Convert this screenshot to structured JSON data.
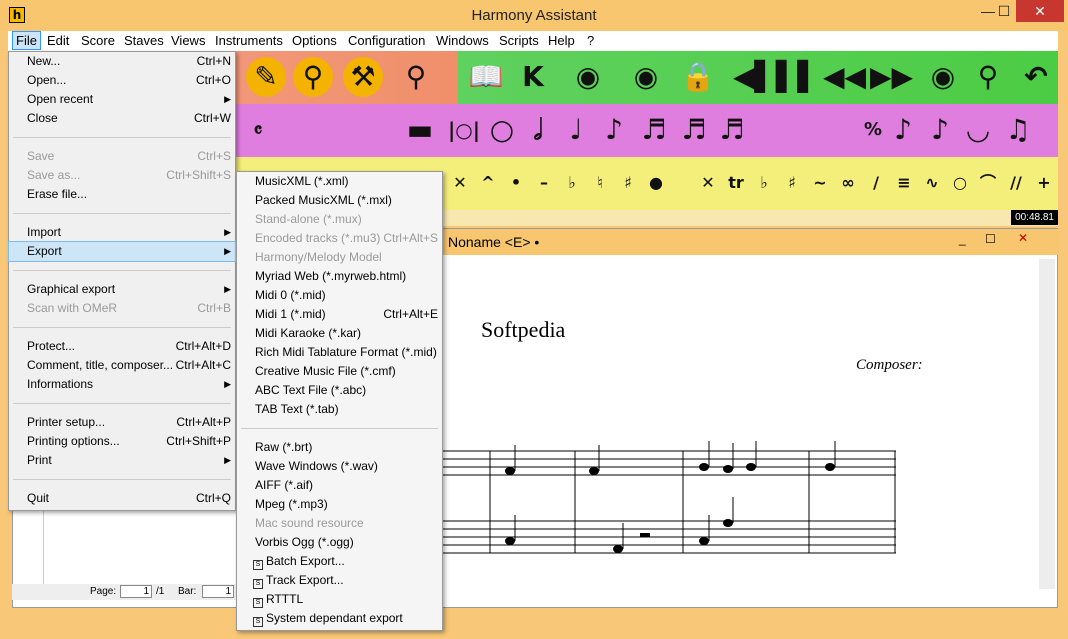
{
  "app": {
    "title": "Harmony Assistant",
    "icon": "h"
  },
  "window_controls": {
    "minimize": "—",
    "maximize": "☐",
    "close": "✕"
  },
  "menubar": [
    "File",
    "Edit",
    "Score",
    "Staves",
    "Views",
    "Instruments",
    "Options",
    "Configuration",
    "Windows",
    "Scripts",
    "Help",
    "?"
  ],
  "file_menu": [
    {
      "label": "New...",
      "shortcut": "Ctrl+N"
    },
    {
      "label": "Open...",
      "shortcut": "Ctrl+O"
    },
    {
      "label": "Open recent",
      "submenu": true
    },
    {
      "label": "Close",
      "shortcut": "Ctrl+W"
    },
    {
      "label": "Save",
      "shortcut": "Ctrl+S",
      "disabled": true
    },
    {
      "label": "Save as...",
      "shortcut": "Ctrl+Shift+S",
      "disabled": true
    },
    {
      "label": "Erase file..."
    },
    {
      "label": "Import",
      "submenu": true
    },
    {
      "label": "Export",
      "submenu": true,
      "highlighted": true
    },
    {
      "label": "Graphical export",
      "submenu": true
    },
    {
      "label": "Scan with OMeR",
      "shortcut": "Ctrl+B",
      "disabled": true
    },
    {
      "label": "Protect...",
      "shortcut": "Ctrl+Alt+D"
    },
    {
      "label": "Comment, title, composer...",
      "shortcut": "Ctrl+Alt+C"
    },
    {
      "label": "Informations",
      "submenu": true
    },
    {
      "label": "Printer setup...",
      "shortcut": "Ctrl+Alt+P"
    },
    {
      "label": "Printing options...",
      "shortcut": "Ctrl+Shift+P"
    },
    {
      "label": "Print",
      "submenu": true
    },
    {
      "label": "Quit",
      "shortcut": "Ctrl+Q"
    }
  ],
  "export_menu": [
    {
      "label": "MusicXML (*.xml)"
    },
    {
      "label": "Packed MusicXML (*.mxl)"
    },
    {
      "label": "Stand-alone (*.mux)",
      "disabled": true
    },
    {
      "label": "Encoded tracks (*.mu3)",
      "shortcut": "Ctrl+Alt+S",
      "disabled": true
    },
    {
      "label": "Harmony/Melody Model",
      "disabled": true
    },
    {
      "label": "Myriad Web (*.myrweb.html)"
    },
    {
      "label": "Midi 0 (*.mid)"
    },
    {
      "label": "Midi 1 (*.mid)",
      "shortcut": "Ctrl+Alt+E"
    },
    {
      "label": "Midi Karaoke (*.kar)"
    },
    {
      "label": "Rich Midi Tablature Format (*.mid)"
    },
    {
      "label": "Creative Music File (*.cmf)"
    },
    {
      "label": "ABC Text File (*.abc)"
    },
    {
      "label": "TAB Text (*.tab)"
    },
    {
      "label": "Raw (*.brt)"
    },
    {
      "label": "Wave Windows (*.wav)"
    },
    {
      "label": "AIFF (*.aif)"
    },
    {
      "label": "Mpeg (*.mp3)"
    },
    {
      "label": "Mac sound resource",
      "disabled": true
    },
    {
      "label": "Vorbis Ogg (*.ogg)"
    },
    {
      "label": "Batch Export...",
      "boxed": true
    },
    {
      "label": "Track Export...",
      "boxed": true
    },
    {
      "label": "RTTTL",
      "boxed": true
    },
    {
      "label": "System dependant export",
      "boxed": true
    }
  ],
  "time_display": "00:48.81",
  "document": {
    "name": "Noname <E> •",
    "score_title": "Softpedia",
    "composer": "Composer:"
  },
  "statusbar": {
    "page_label": "Page:",
    "page_value": "1",
    "page_total": "/1",
    "bar_label": "Bar:",
    "bar_value": "1"
  },
  "colors": {
    "toolbar1_left": "#f08f6a",
    "toolbar1_right": "#4ccc44",
    "toolbar2": "#e07ee0",
    "toolbar3": "#f4ee7a",
    "titlebar": "#f7c66f",
    "menu_highlight": "#cde6f7"
  }
}
